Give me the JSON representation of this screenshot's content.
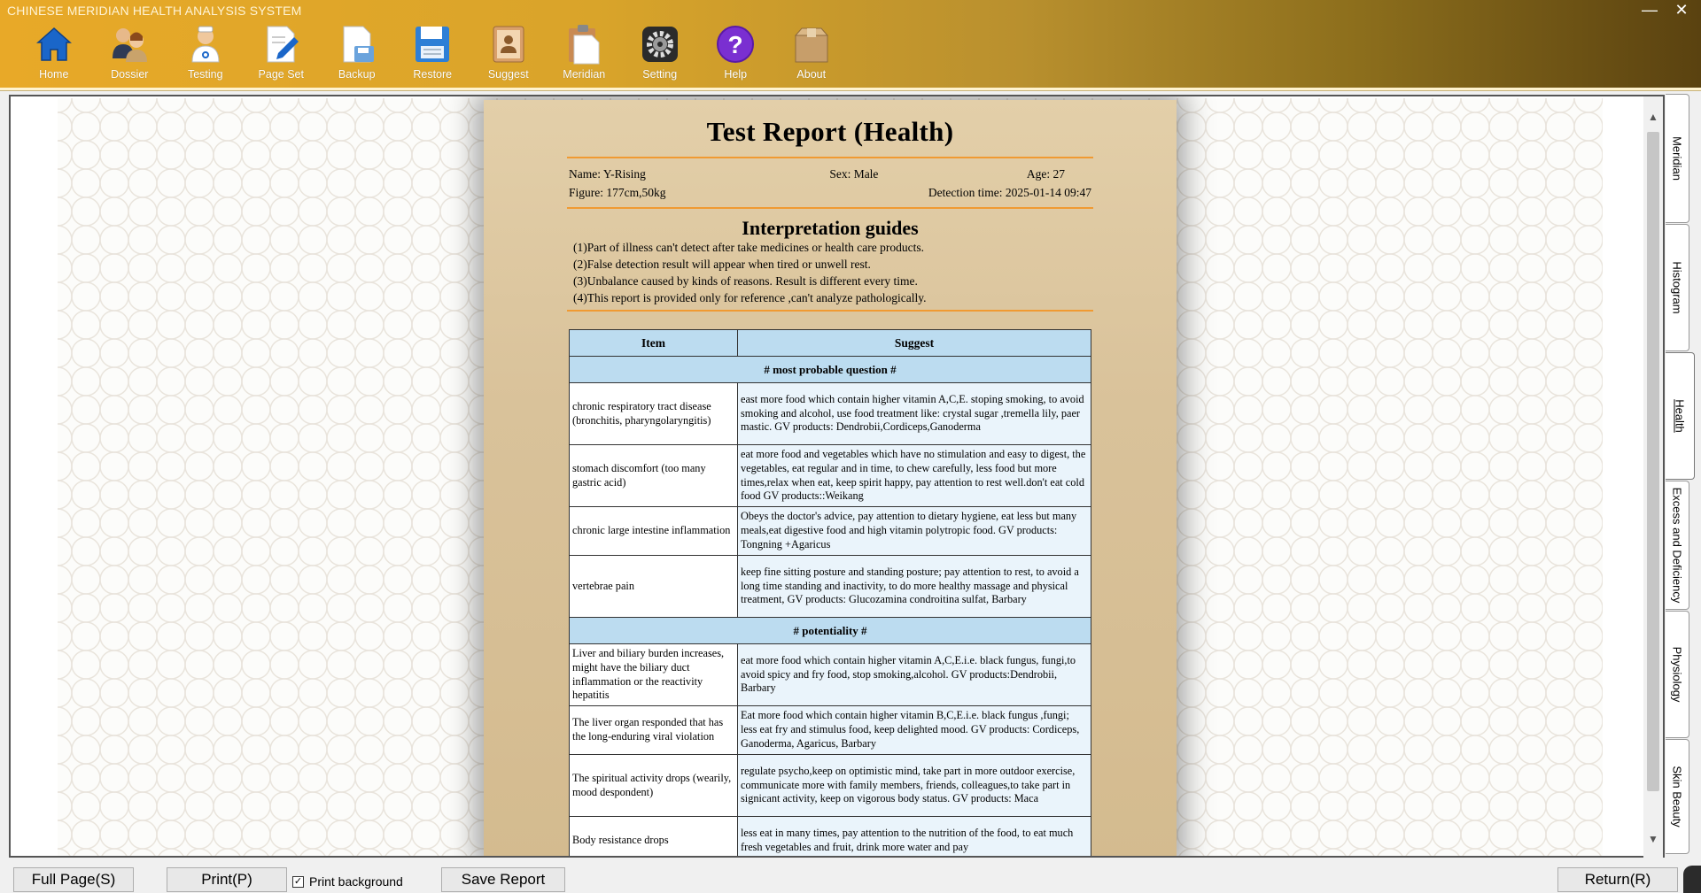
{
  "window": {
    "title": "CHINESE MERIDIAN HEALTH ANALYSIS SYSTEM",
    "minimize": "—",
    "close": "✕"
  },
  "toolbar": [
    {
      "label": "Home",
      "icon": "home-icon"
    },
    {
      "label": "Dossier",
      "icon": "users-icon"
    },
    {
      "label": "Testing",
      "icon": "doctor-icon"
    },
    {
      "label": "Page Set",
      "icon": "edit-page-icon"
    },
    {
      "label": "Backup",
      "icon": "backup-icon"
    },
    {
      "label": "Restore",
      "icon": "save-icon"
    },
    {
      "label": "Suggest",
      "icon": "contact-book-icon"
    },
    {
      "label": "Meridian",
      "icon": "clipboard-icon"
    },
    {
      "label": "Setting",
      "icon": "gear-icon"
    },
    {
      "label": "Help",
      "icon": "help-icon"
    },
    {
      "label": "About",
      "icon": "box-icon"
    }
  ],
  "report": {
    "title": "Test Report (Health)",
    "name": "Name: Y-Rising",
    "sex": "Sex: Male",
    "age": "Age: 27",
    "figure": "Figure: 177cm,50kg",
    "detection_time": "Detection time: 2025-01-14 09:47",
    "guides_title": "Interpretation guides",
    "guides": [
      "(1)Part of illness can't detect after take medicines or health care products.",
      "(2)False detection result will appear when tired or unwell rest.",
      "(3)Unbalance caused by kinds of reasons. Result is different every time.",
      "(4)This report is provided only for reference ,can't analyze pathologically."
    ],
    "table": {
      "headers": {
        "item": "Item",
        "suggest": "Suggest"
      },
      "section1": "# most probable question #",
      "rows1": [
        {
          "item": "chronic respiratory tract disease (bronchitis, pharyngolaryngitis)",
          "suggest": " east more food which contain higher vitamin A,C,E. stoping smoking, to avoid smoking and alcohol, use food treatment like: crystal sugar ,tremella lily, paer mastic. GV products: Dendrobii,Cordiceps,Ganoderma"
        },
        {
          "item": "stomach discomfort (too many gastric acid)",
          "suggest": " eat more food and vegetables which have no stimulation and easy to digest, the vegetables, eat regular and in time, to chew carefully, less food but more times,relax when eat, keep spirit happy, pay attention to rest well.don't eat cold food GV products::Weikang"
        },
        {
          "item": "chronic large intestine inflammation",
          "suggest": " Obeys the doctor's advice, pay attention to dietary hygiene, eat less but many meals,eat digestive food and high vitamin polytropic food. GV products: Tongning +Agaricus"
        },
        {
          "item": "vertebrae pain",
          "suggest": " keep fine sitting posture and standing posture; pay attention to rest, to avoid a long time standing and inactivity, to do more healthy massage and physical treatment, GV products: Glucozamina condroitina sulfat, Barbary"
        }
      ],
      "section2": "# potentiality #",
      "rows2": [
        {
          "item": "Liver and biliary burden increases, might have the biliary duct inflammation or the reactivity hepatitis",
          "suggest": " eat more food which contain higher vitamin A,C,E.i.e. black fungus, fungi,to avoid spicy and fry food, stop smoking,alcohol. GV products:Dendrobii, Barbary"
        },
        {
          "item": "The liver organ responded that has the long-enduring viral violation",
          "suggest": " Eat more food which contain higher vitamin B,C,E.i.e. black fungus ,fungi; less eat fry and stimulus food, keep delighted mood. GV products: Cordiceps, Ganoderma, Agaricus, Barbary"
        },
        {
          "item": "The spiritual activity drops (wearily, mood despondent)",
          "suggest": " regulate psycho,keep on optimistic mind, take part in more outdoor exercise, communicate more with family members, friends, colleagues,to take part in signicant activity, keep on vigorous body status. GV products: Maca"
        },
        {
          "item": "Body resistance drops",
          "suggest": " less eat in many times, pay attention to the nutrition of the food, to eat much fresh vegetables and fruit, drink more water and pay"
        }
      ]
    }
  },
  "side_tabs": [
    "Meridian",
    "Histogram",
    "Health",
    "Excess and Deficiency",
    "Physiology",
    "Skin Beauty"
  ],
  "bottom": {
    "full_page": "Full Page(S)",
    "print": "Print(P)",
    "print_background": "Print background",
    "print_background_checked": "✓",
    "save_report": "Save Report",
    "return": "Return(R)"
  }
}
